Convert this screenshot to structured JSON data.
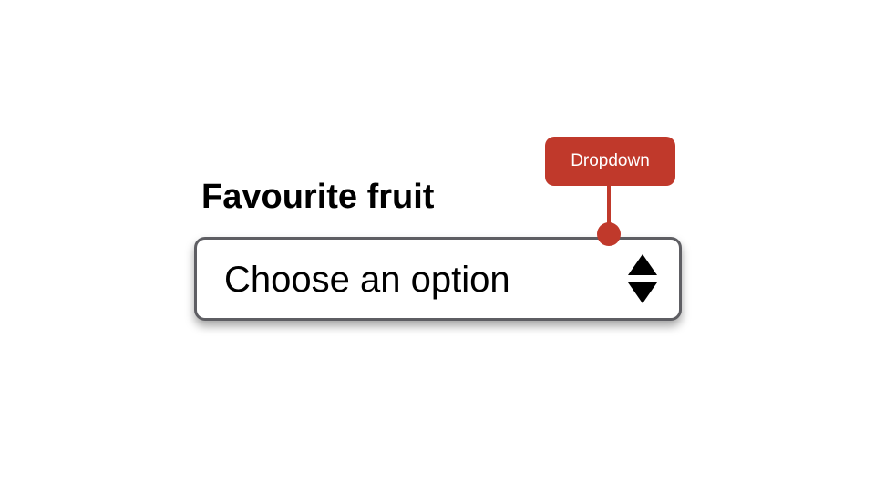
{
  "field": {
    "label": "Favourite fruit",
    "selected_value": "Choose an option",
    "indicator_icon": "up-down-arrows-icon"
  },
  "annotation": {
    "label": "Dropdown",
    "color": "#c0392b"
  }
}
